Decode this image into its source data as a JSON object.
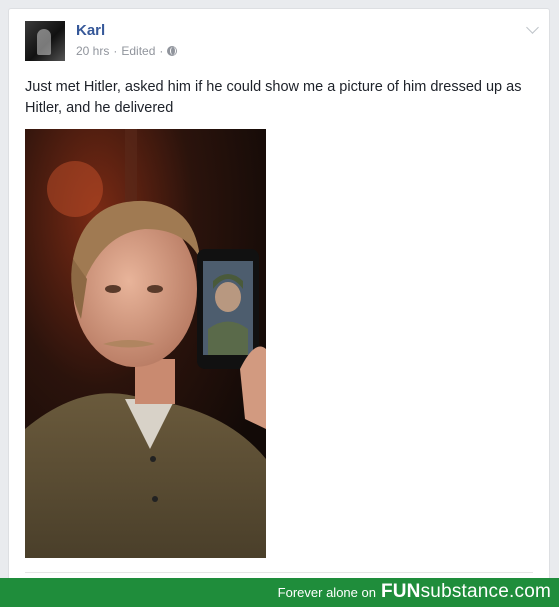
{
  "post": {
    "author": "Karl",
    "time": "20 hrs",
    "separator": "·",
    "edited": "Edited",
    "text": "Just met Hitler, asked him if he could show me a picture of him dressed up as Hitler, and he delivered",
    "privacy_icon": "globe-icon",
    "menu_icon": "chevron-down-icon",
    "photo_alt": "photo"
  },
  "watermark": {
    "prefix": "Forever alone on",
    "brand_bold": "FUN",
    "brand_rest": "substance.com"
  },
  "colors": {
    "author_link": "#365899",
    "meta_grey": "#90949c",
    "footer_green": "#1f8d3b"
  }
}
